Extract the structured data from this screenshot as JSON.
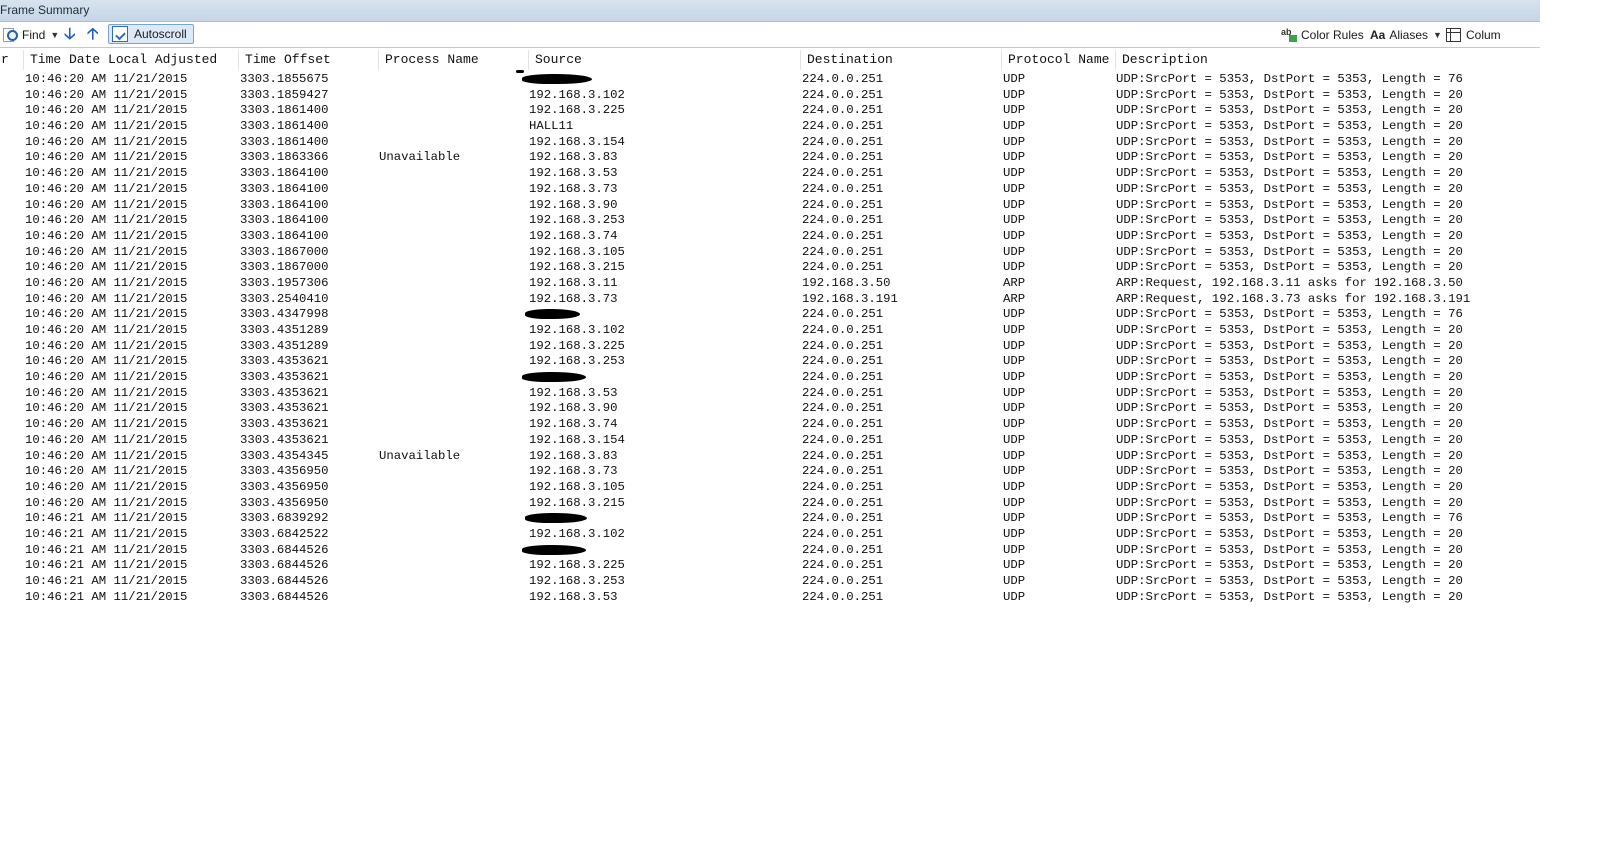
{
  "window": {
    "title": "Frame Summary"
  },
  "toolbar": {
    "find_label": "Find",
    "find_caret": "▼",
    "down_arrow": "🡣",
    "up_arrow": "🡡",
    "autoscroll_label": "Autoscroll",
    "colorrules_label": "Color Rules",
    "aliases_label": "Aliases",
    "aliases_caret": "▼",
    "columns_label": "Colum"
  },
  "columns": {
    "number": "r",
    "time": "Time Date Local Adjusted",
    "offset": "Time Offset",
    "process": "Process Name",
    "source": "Source",
    "destination": "Destination",
    "protocol": "Protocol Name",
    "description": "Description"
  },
  "rows": [
    {
      "time": "10:46:20 AM 11/21/2015",
      "offset": "3303.1855675",
      "process": "",
      "source": "",
      "source_redacted": true,
      "destination": "224.0.0.251",
      "protocol": "UDP",
      "description": "UDP:SrcPort = 5353, DstPort = 5353, Length = 76"
    },
    {
      "time": "10:46:20 AM 11/21/2015",
      "offset": "3303.1859427",
      "process": "",
      "source": "192.168.3.102",
      "destination": "224.0.0.251",
      "protocol": "UDP",
      "description": "UDP:SrcPort = 5353, DstPort = 5353, Length = 20"
    },
    {
      "time": "10:46:20 AM 11/21/2015",
      "offset": "3303.1861400",
      "process": "",
      "source": "192.168.3.225",
      "destination": "224.0.0.251",
      "protocol": "UDP",
      "description": "UDP:SrcPort = 5353, DstPort = 5353, Length = 20"
    },
    {
      "time": "10:46:20 AM 11/21/2015",
      "offset": "3303.1861400",
      "process": "",
      "source": "HALL11",
      "destination": "224.0.0.251",
      "protocol": "UDP",
      "description": "UDP:SrcPort = 5353, DstPort = 5353, Length = 20"
    },
    {
      "time": "10:46:20 AM 11/21/2015",
      "offset": "3303.1861400",
      "process": "",
      "source": "192.168.3.154",
      "destination": "224.0.0.251",
      "protocol": "UDP",
      "description": "UDP:SrcPort = 5353, DstPort = 5353, Length = 20"
    },
    {
      "time": "10:46:20 AM 11/21/2015",
      "offset": "3303.1863366",
      "process": "Unavailable",
      "source": "192.168.3.83",
      "destination": "224.0.0.251",
      "protocol": "UDP",
      "description": "UDP:SrcPort = 5353, DstPort = 5353, Length = 20"
    },
    {
      "time": "10:46:20 AM 11/21/2015",
      "offset": "3303.1864100",
      "process": "",
      "source": "192.168.3.53",
      "destination": "224.0.0.251",
      "protocol": "UDP",
      "description": "UDP:SrcPort = 5353, DstPort = 5353, Length = 20"
    },
    {
      "time": "10:46:20 AM 11/21/2015",
      "offset": "3303.1864100",
      "process": "",
      "source": "192.168.3.73",
      "destination": "224.0.0.251",
      "protocol": "UDP",
      "description": "UDP:SrcPort = 5353, DstPort = 5353, Length = 20"
    },
    {
      "time": "10:46:20 AM 11/21/2015",
      "offset": "3303.1864100",
      "process": "",
      "source": "192.168.3.90",
      "destination": "224.0.0.251",
      "protocol": "UDP",
      "description": "UDP:SrcPort = 5353, DstPort = 5353, Length = 20"
    },
    {
      "time": "10:46:20 AM 11/21/2015",
      "offset": "3303.1864100",
      "process": "",
      "source": "192.168.3.253",
      "destination": "224.0.0.251",
      "protocol": "UDP",
      "description": "UDP:SrcPort = 5353, DstPort = 5353, Length = 20"
    },
    {
      "time": "10:46:20 AM 11/21/2015",
      "offset": "3303.1864100",
      "process": "",
      "source": "192.168.3.74",
      "destination": "224.0.0.251",
      "protocol": "UDP",
      "description": "UDP:SrcPort = 5353, DstPort = 5353, Length = 20"
    },
    {
      "time": "10:46:20 AM 11/21/2015",
      "offset": "3303.1867000",
      "process": "",
      "source": "192.168.3.105",
      "destination": "224.0.0.251",
      "protocol": "UDP",
      "description": "UDP:SrcPort = 5353, DstPort = 5353, Length = 20"
    },
    {
      "time": "10:46:20 AM 11/21/2015",
      "offset": "3303.1867000",
      "process": "",
      "source": "192.168.3.215",
      "destination": "224.0.0.251",
      "protocol": "UDP",
      "description": "UDP:SrcPort = 5353, DstPort = 5353, Length = 20"
    },
    {
      "time": "10:46:20 AM 11/21/2015",
      "offset": "3303.1957306",
      "process": "",
      "source": "192.168.3.11",
      "destination": "192.168.3.50",
      "protocol": "ARP",
      "description": "ARP:Request, 192.168.3.11 asks for 192.168.3.50"
    },
    {
      "time": "10:46:20 AM 11/21/2015",
      "offset": "3303.2540410",
      "process": "",
      "source": "192.168.3.73",
      "destination": "192.168.3.191",
      "protocol": "ARP",
      "description": "ARP:Request, 192.168.3.73 asks for 192.168.3.191"
    },
    {
      "time": "10:46:20 AM 11/21/2015",
      "offset": "3303.4347998",
      "process": "",
      "source": "",
      "source_redacted": true,
      "destination": "224.0.0.251",
      "protocol": "UDP",
      "description": "UDP:SrcPort = 5353, DstPort = 5353, Length = 76"
    },
    {
      "time": "10:46:20 AM 11/21/2015",
      "offset": "3303.4351289",
      "process": "",
      "source": "192.168.3.102",
      "destination": "224.0.0.251",
      "protocol": "UDP",
      "description": "UDP:SrcPort = 5353, DstPort = 5353, Length = 20"
    },
    {
      "time": "10:46:20 AM 11/21/2015",
      "offset": "3303.4351289",
      "process": "",
      "source": "192.168.3.225",
      "destination": "224.0.0.251",
      "protocol": "UDP",
      "description": "UDP:SrcPort = 5353, DstPort = 5353, Length = 20"
    },
    {
      "time": "10:46:20 AM 11/21/2015",
      "offset": "3303.4353621",
      "process": "",
      "source": "192.168.3.253",
      "destination": "224.0.0.251",
      "protocol": "UDP",
      "description": "UDP:SrcPort = 5353, DstPort = 5353, Length = 20"
    },
    {
      "time": "10:46:20 AM 11/21/2015",
      "offset": "3303.4353621",
      "process": "",
      "source": "",
      "source_redacted": true,
      "destination": "224.0.0.251",
      "protocol": "UDP",
      "description": "UDP:SrcPort = 5353, DstPort = 5353, Length = 20"
    },
    {
      "time": "10:46:20 AM 11/21/2015",
      "offset": "3303.4353621",
      "process": "",
      "source": "192.168.3.53",
      "destination": "224.0.0.251",
      "protocol": "UDP",
      "description": "UDP:SrcPort = 5353, DstPort = 5353, Length = 20"
    },
    {
      "time": "10:46:20 AM 11/21/2015",
      "offset": "3303.4353621",
      "process": "",
      "source": "192.168.3.90",
      "destination": "224.0.0.251",
      "protocol": "UDP",
      "description": "UDP:SrcPort = 5353, DstPort = 5353, Length = 20"
    },
    {
      "time": "10:46:20 AM 11/21/2015",
      "offset": "3303.4353621",
      "process": "",
      "source": "192.168.3.74",
      "destination": "224.0.0.251",
      "protocol": "UDP",
      "description": "UDP:SrcPort = 5353, DstPort = 5353, Length = 20"
    },
    {
      "time": "10:46:20 AM 11/21/2015",
      "offset": "3303.4353621",
      "process": "",
      "source": "192.168.3.154",
      "destination": "224.0.0.251",
      "protocol": "UDP",
      "description": "UDP:SrcPort = 5353, DstPort = 5353, Length = 20"
    },
    {
      "time": "10:46:20 AM 11/21/2015",
      "offset": "3303.4354345",
      "process": "Unavailable",
      "source": "192.168.3.83",
      "destination": "224.0.0.251",
      "protocol": "UDP",
      "description": "UDP:SrcPort = 5353, DstPort = 5353, Length = 20"
    },
    {
      "time": "10:46:20 AM 11/21/2015",
      "offset": "3303.4356950",
      "process": "",
      "source": "192.168.3.73",
      "destination": "224.0.0.251",
      "protocol": "UDP",
      "description": "UDP:SrcPort = 5353, DstPort = 5353, Length = 20"
    },
    {
      "time": "10:46:20 AM 11/21/2015",
      "offset": "3303.4356950",
      "process": "",
      "source": "192.168.3.105",
      "destination": "224.0.0.251",
      "protocol": "UDP",
      "description": "UDP:SrcPort = 5353, DstPort = 5353, Length = 20"
    },
    {
      "time": "10:46:20 AM 11/21/2015",
      "offset": "3303.4356950",
      "process": "",
      "source": "192.168.3.215",
      "destination": "224.0.0.251",
      "protocol": "UDP",
      "description": "UDP:SrcPort = 5353, DstPort = 5353, Length = 20"
    },
    {
      "time": "10:46:21 AM 11/21/2015",
      "offset": "3303.6839292",
      "process": "",
      "source": "",
      "source_redacted": true,
      "destination": "224.0.0.251",
      "protocol": "UDP",
      "description": "UDP:SrcPort = 5353, DstPort = 5353, Length = 76"
    },
    {
      "time": "10:46:21 AM 11/21/2015",
      "offset": "3303.6842522",
      "process": "",
      "source": "192.168.3.102",
      "destination": "224.0.0.251",
      "protocol": "UDP",
      "description": "UDP:SrcPort = 5353, DstPort = 5353, Length = 20"
    },
    {
      "time": "10:46:21 AM 11/21/2015",
      "offset": "3303.6844526",
      "process": "",
      "source": "",
      "source_redacted": true,
      "destination": "224.0.0.251",
      "protocol": "UDP",
      "description": "UDP:SrcPort = 5353, DstPort = 5353, Length = 20"
    },
    {
      "time": "10:46:21 AM 11/21/2015",
      "offset": "3303.6844526",
      "process": "",
      "source": "192.168.3.225",
      "destination": "224.0.0.251",
      "protocol": "UDP",
      "description": "UDP:SrcPort = 5353, DstPort = 5353, Length = 20"
    },
    {
      "time": "10:46:21 AM 11/21/2015",
      "offset": "3303.6844526",
      "process": "",
      "source": "192.168.3.253",
      "destination": "224.0.0.251",
      "protocol": "UDP",
      "description": "UDP:SrcPort = 5353, DstPort = 5353, Length = 20"
    },
    {
      "time": "10:46:21 AM 11/21/2015",
      "offset": "3303.6844526",
      "process": "",
      "source": "192.168.3.53",
      "destination": "224.0.0.251",
      "protocol": "UDP",
      "description": "UDP:SrcPort = 5353, DstPort = 5353, Length = 20"
    }
  ]
}
